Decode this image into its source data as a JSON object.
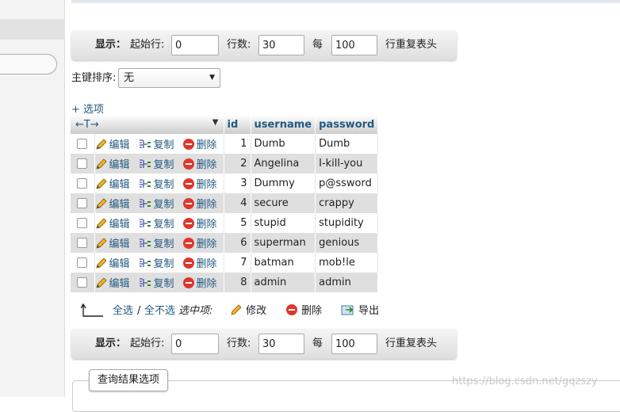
{
  "nav_controls": {
    "show_label": "显示：",
    "start_row_label": "起始行:",
    "start_row_value": "0",
    "rows_label": "行数:",
    "rows_value": "30",
    "every_label": "每",
    "header_every_value": "100",
    "repeat_header_label": "行重复表头"
  },
  "sort": {
    "label": "主键排序:",
    "selected": "无"
  },
  "options_link": "+ 选项",
  "table": {
    "arrows": "←T→",
    "columns": [
      "id",
      "username",
      "password"
    ],
    "action_labels": {
      "edit": "编辑",
      "copy": "复制",
      "delete": "删除"
    },
    "rows": [
      {
        "id": "1",
        "username": "Dumb",
        "password": "Dumb"
      },
      {
        "id": "2",
        "username": "Angelina",
        "password": "I-kill-you"
      },
      {
        "id": "3",
        "username": "Dummy",
        "password": "p@ssword"
      },
      {
        "id": "4",
        "username": "secure",
        "password": "crappy"
      },
      {
        "id": "5",
        "username": "stupid",
        "password": "stupidity"
      },
      {
        "id": "6",
        "username": "superman",
        "password": "genious"
      },
      {
        "id": "7",
        "username": "batman",
        "password": "mob!le"
      },
      {
        "id": "8",
        "username": "admin",
        "password": "admin"
      }
    ]
  },
  "bulk_actions": {
    "check_all": "全选",
    "separator": "/",
    "uncheck_all": "全不选",
    "with_selected": "选中项:",
    "edit": "修改",
    "delete": "删除",
    "export": "导出"
  },
  "result_options_tab": "查询结果选项",
  "watermark": "https://blog.csdn.net/gqzszy",
  "colors": {
    "link": "#235a81",
    "row_alt": "#dfdfdf",
    "delete_icon": "#e0362c",
    "edit_icon": "#f0b429"
  }
}
